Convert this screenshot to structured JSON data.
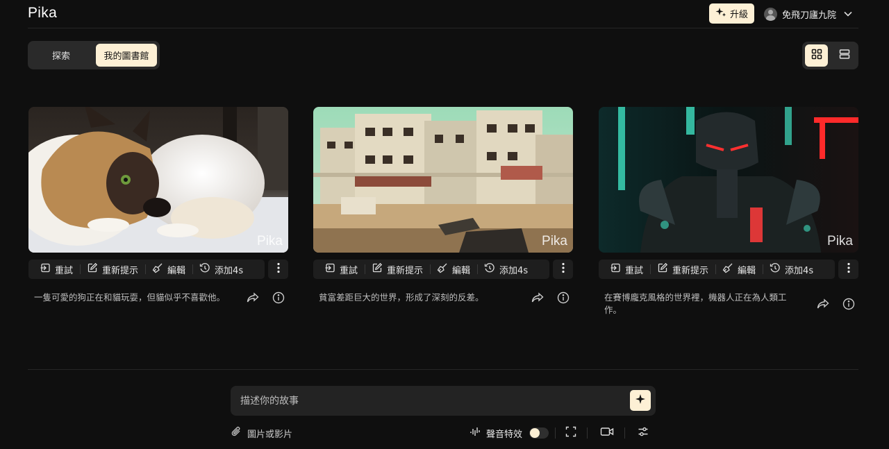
{
  "header": {
    "logo": "Pika",
    "upgrade_label": "升級",
    "username": "免飛刀廬九院"
  },
  "tabs": [
    {
      "label": "探索",
      "active": false
    },
    {
      "label": "我的圖書館",
      "active": true
    }
  ],
  "view_modes": [
    "grid",
    "list"
  ],
  "card_actions": {
    "retry": "重試",
    "reprompt": "重新提示",
    "edit": "編輯",
    "add_time": "添加4s"
  },
  "watermark": "Pika",
  "cards": [
    {
      "description": "一隻可愛的狗正在和貓玩耍，但貓似乎不喜歡他。"
    },
    {
      "description": "貧富差距巨大的世界，形成了深刻的反差。"
    },
    {
      "description": "在賽博龐克風格的世界裡，機器人正在為人類工作。"
    }
  ],
  "prompt": {
    "placeholder": "描述你的故事"
  },
  "bottom_bar": {
    "attach_label": "圖片或影片",
    "sound_effects_label": "聲音特效",
    "sound_effects_on": false
  },
  "colors": {
    "background": "#0f0f0f",
    "accent": "#fdf0d5",
    "panel": "#2a2a2a"
  }
}
